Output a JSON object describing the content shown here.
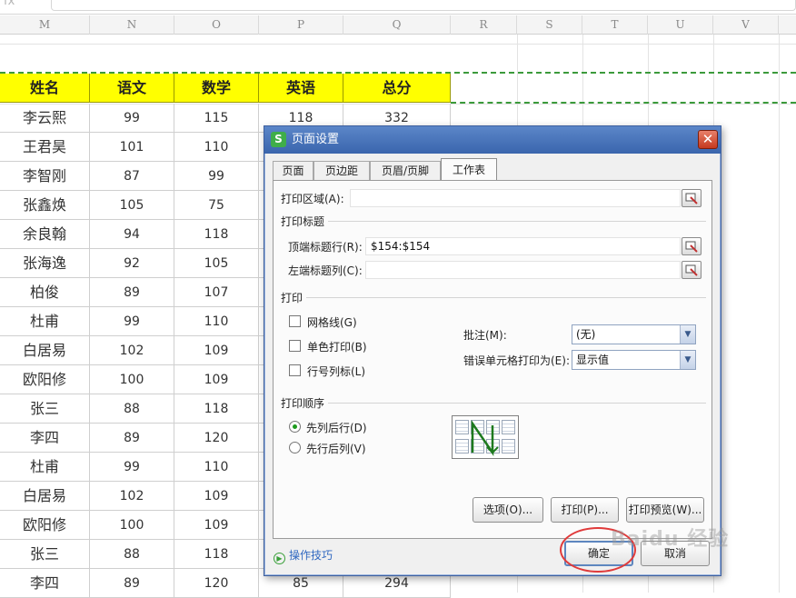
{
  "formula_bar": {
    "fx_label": "fx"
  },
  "columns": [
    "M",
    "N",
    "O",
    "P",
    "Q",
    "R",
    "S",
    "T",
    "U",
    "V"
  ],
  "table": {
    "headers": [
      "姓名",
      "语文",
      "数学",
      "英语",
      "总分"
    ],
    "rows": [
      [
        "李云熙",
        "99",
        "115",
        "118",
        "332"
      ],
      [
        "王君昊",
        "101",
        "110",
        "",
        ""
      ],
      [
        "李智刚",
        "87",
        "99",
        "",
        ""
      ],
      [
        "张鑫焕",
        "105",
        "75",
        "",
        ""
      ],
      [
        "余良翰",
        "94",
        "118",
        "",
        ""
      ],
      [
        "张海逸",
        "92",
        "105",
        "",
        ""
      ],
      [
        "柏俊",
        "89",
        "107",
        "",
        ""
      ],
      [
        "杜甫",
        "99",
        "110",
        "",
        ""
      ],
      [
        "白居易",
        "102",
        "109",
        "",
        ""
      ],
      [
        "欧阳修",
        "100",
        "109",
        "",
        ""
      ],
      [
        "张三",
        "88",
        "118",
        "",
        ""
      ],
      [
        "李四",
        "89",
        "120",
        "",
        ""
      ],
      [
        "杜甫",
        "99",
        "110",
        "",
        ""
      ],
      [
        "白居易",
        "102",
        "109",
        "",
        ""
      ],
      [
        "欧阳修",
        "100",
        "109",
        "",
        ""
      ],
      [
        "张三",
        "88",
        "118",
        "",
        ""
      ],
      [
        "李四",
        "89",
        "120",
        "85",
        "294"
      ]
    ]
  },
  "dialog": {
    "title": "页面设置",
    "app_icon": "S",
    "close": "✕",
    "tabs": [
      "页面",
      "页边距",
      "页眉/页脚",
      "工作表"
    ],
    "active_tab": "工作表",
    "print_area_label": "打印区域(A):",
    "print_area_value": "",
    "print_titles_section": "打印标题",
    "top_rows_label": "顶端标题行(R):",
    "top_rows_value": "$154:$154",
    "left_cols_label": "左端标题列(C):",
    "left_cols_value": "",
    "print_section": "打印",
    "gridlines_label": "网格线(G)",
    "mono_label": "单色打印(B)",
    "rowcol_label": "行号列标(L)",
    "comments_label": "批注(M):",
    "comments_value": "(无)",
    "errors_label": "错误单元格打印为(E):",
    "errors_value": "显示值",
    "order_section": "打印顺序",
    "order_down_label": "先列后行(D)",
    "order_over_label": "先行后列(V)",
    "order_selected": "先列后行(D)",
    "options_button": "选项(O)...",
    "print_button": "打印(P)...",
    "preview_button": "打印预览(W)...",
    "tips_label": "操作技巧",
    "ok_button": "确定",
    "cancel_button": "取消"
  },
  "watermark": "Baidu 经验",
  "colors": {
    "header_fill": "#ffff00",
    "dash": "#3b9a3b",
    "highlight_ring": "#e03a3a",
    "title_bar": "#3a65ad"
  }
}
